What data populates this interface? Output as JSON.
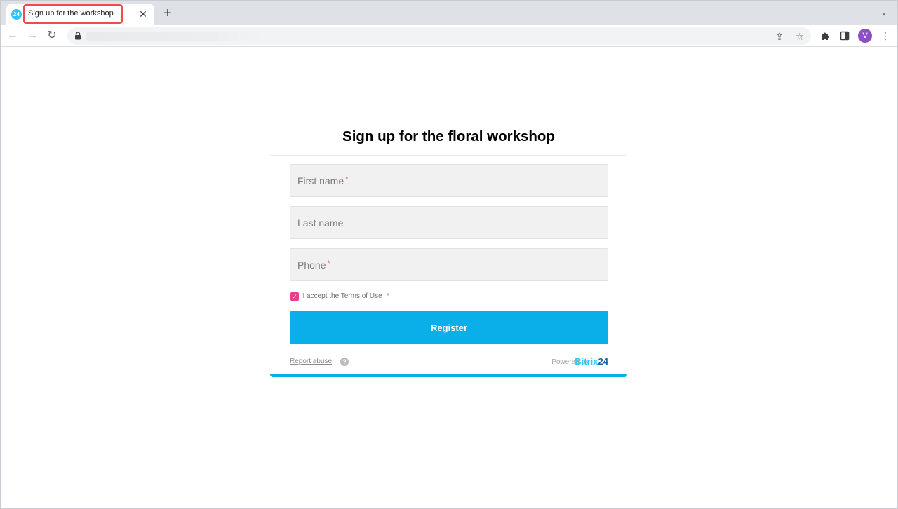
{
  "browser": {
    "tab": {
      "favicon_text": "24",
      "title": "Sign up for the workshop",
      "close_icon": "close-icon",
      "highlight_color": "#ef4b4b"
    },
    "new_tab_icon": "plus-icon",
    "tab_search_icon": "chevron-down-icon",
    "toolbar": {
      "back_icon": "arrow-left-icon",
      "forward_icon": "arrow-right-icon",
      "reload_icon": "reload-icon",
      "address_icon": "lock-icon",
      "share_icon": "share-icon",
      "bookmark_icon": "star-icon",
      "extensions_icon": "puzzle-icon",
      "side_panel_icon": "side-panel-icon",
      "profile_initial": "V",
      "menu_icon": "kebab-menu-icon"
    }
  },
  "form": {
    "title": "Sign up for the floral workshop",
    "fields": [
      {
        "placeholder": "First name",
        "required_mark": "*"
      },
      {
        "placeholder": "Last name",
        "required_mark": ""
      },
      {
        "placeholder": "Phone",
        "required_mark": "*"
      }
    ],
    "terms": {
      "checked": true,
      "label": "I accept the Terms of Use",
      "required_mark": "*"
    },
    "submit_label": "Register",
    "footer": {
      "report_abuse": "Report abuse",
      "powered_by": "Powered by",
      "brand_part1": "Bitrix",
      "brand_part2": "24"
    }
  },
  "colors": {
    "accent": "#0aaee8",
    "checkbox": "#e83e8c",
    "required": "#f25c5c"
  }
}
